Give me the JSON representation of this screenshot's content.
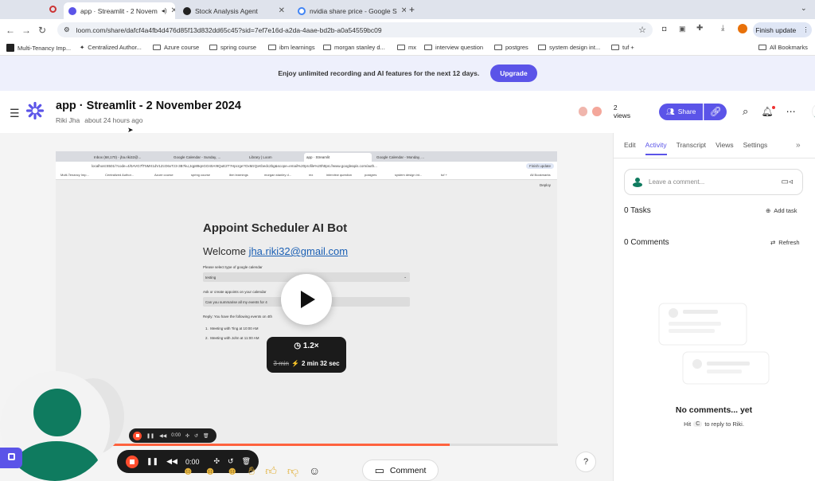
{
  "browser": {
    "tabs": [
      {
        "label": "app · Streamlit - 2 Novem",
        "active": true
      },
      {
        "label": "Stock Analysis Agent",
        "active": false
      },
      {
        "label": "nvidia share price - Google S",
        "active": false
      }
    ],
    "url": "loom.com/share/dafcf4a4fb4d476d85f13d832dd65c45?sid=7ef7e16d-a2da-4aae-bd2b-a0a54559bc09",
    "finish_update": "Finish update",
    "bookmarks": [
      "Multi-Tenancy Imp...",
      "Centralized Author...",
      "Azure course",
      "spring course",
      "ibm learnings",
      "morgan stanley d...",
      "mx",
      "interview question",
      "postgres",
      "system design int...",
      "tuf +"
    ],
    "all_bookmarks": "All Bookmarks"
  },
  "banner": {
    "text": "Enjoy unlimited recording and AI features for the next 12 days.",
    "cta": "Upgrade"
  },
  "header": {
    "title": "app · Streamlit - 2 November 2024",
    "author": "Riki Jha",
    "time": "about 24 hours ago",
    "views": "2 views",
    "share": "Share"
  },
  "video": {
    "inner_tabs": [
      "Inbox (68,170) - jha.riki32@...",
      "Google Calendar - Sunday, ...",
      "Library | Loom",
      "app · Streamlit",
      "Google Calendar - Monday, ..."
    ],
    "inner_url": "localhost:8501/?code=4/0AVG7fT5MX1dV1ZcO6xTz3-3B?ku;Jqp89qnGO40A!9QuE2T?Hpcrge?OxMzQxKbedc2bg&scope=email%20profile%20https://www.googleapis.com/auth...",
    "inner_finish": "Finish update",
    "inner_bookmarks": [
      "Multi-Tenancy Imp...",
      "Centralized Author...",
      "Azure course",
      "spring course",
      "ibm learnings",
      "morgan stanley d...",
      "mx",
      "interview question",
      "postgres",
      "system design int...",
      "tuf +"
    ],
    "inner_all_bookmarks": "All Bookmarks",
    "deploy": "Deploy",
    "heading": "Appoint Scheduler AI Bot",
    "welcome": "Welcome ",
    "email": "jha.riki32@gmail.com",
    "select_label": "Please select type of google calendar",
    "select_value": "testing",
    "ask_label": "Ask or create appoints on your calendar",
    "ask_value": "Can you summarise all my events for 4",
    "reply": "Reply: You have the following events on 4th",
    "events": [
      "Meeting with Ting at 10:00 AM",
      "Meeting with John at 11:00 AM"
    ],
    "speed": "1.2×",
    "original_duration": "3 min",
    "new_duration": "2 min 32 sec",
    "progress": 0.76
  },
  "recorder": {
    "time": "0:00",
    "mini_time": "0:00"
  },
  "comment_button": "Comment",
  "help": "?",
  "panel": {
    "tabs": [
      "Edit",
      "Activity",
      "Transcript",
      "Views",
      "Settings"
    ],
    "active_tab": "Activity",
    "comment_placeholder": "Leave a comment...",
    "tasks_title": "0 Tasks",
    "add_task": "Add task",
    "comments_title": "0 Comments",
    "refresh": "Refresh",
    "empty_title": "No comments... yet",
    "hint_pre": "Hit",
    "hint_key": "C",
    "hint_post": "to reply to Riki."
  },
  "colors": {
    "accent": "#5b54e8",
    "progress": "#ff623e",
    "avatar": "#0f7b5f"
  }
}
